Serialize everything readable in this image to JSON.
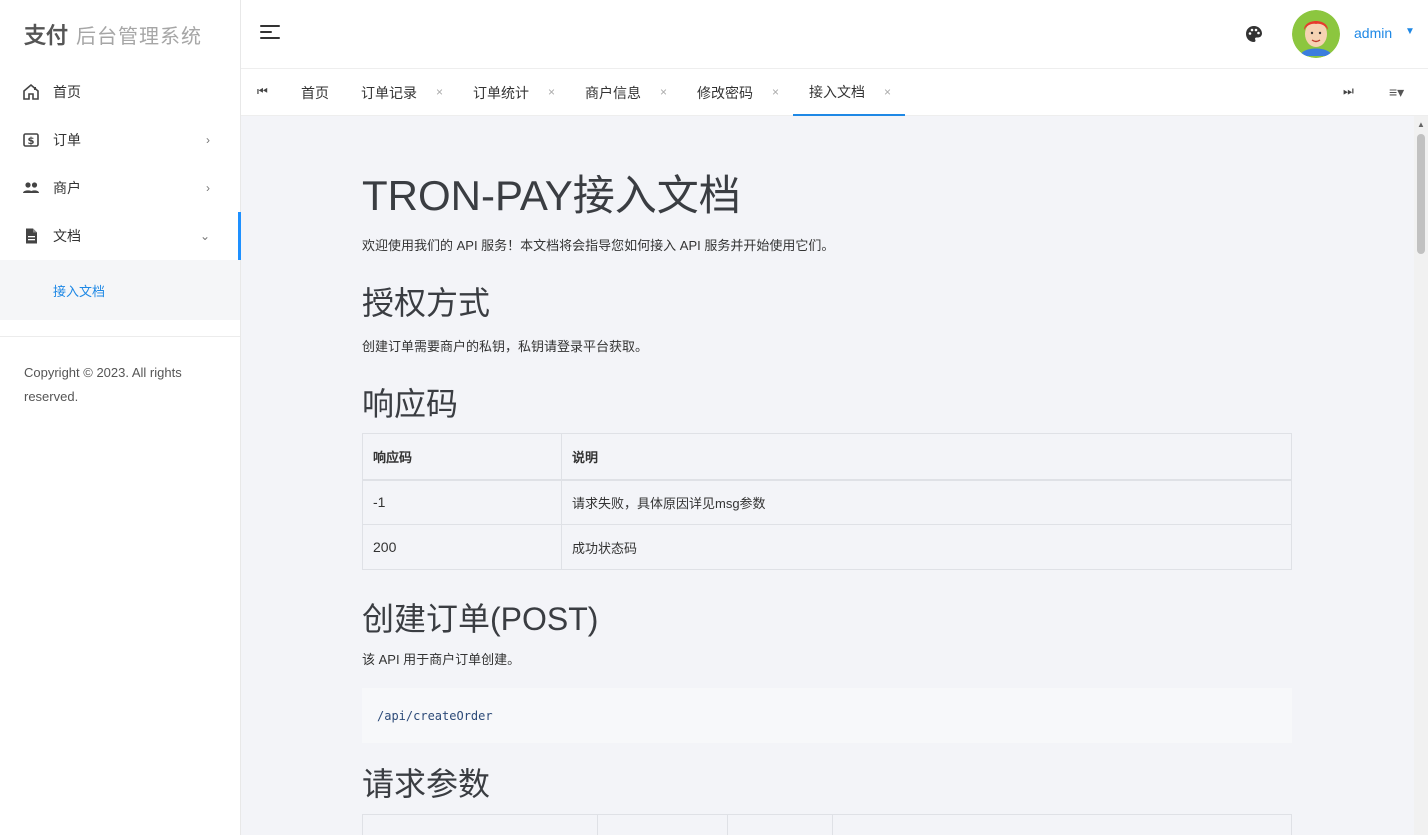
{
  "brand": {
    "mark": "支付",
    "title": "后台管理系统"
  },
  "sidebar": {
    "items": [
      {
        "label": "首页",
        "icon": "home-icon"
      },
      {
        "label": "订单",
        "icon": "dollar-card-icon",
        "chevron": "›"
      },
      {
        "label": "商户",
        "icon": "people-icon",
        "chevron": "›"
      },
      {
        "label": "文档",
        "icon": "document-icon",
        "chevron": "⌄"
      }
    ],
    "sub_item": "接入文档",
    "copyright": "Copyright © 2023. All rights reserved."
  },
  "header": {
    "user": "admin",
    "caret": "▼"
  },
  "tabs": [
    {
      "label": "首页"
    },
    {
      "label": "订单记录",
      "close": "×"
    },
    {
      "label": "订单统计",
      "close": "×"
    },
    {
      "label": "商户信息",
      "close": "×"
    },
    {
      "label": "修改密码",
      "close": "×"
    },
    {
      "label": "接入文档",
      "close": "×"
    }
  ],
  "tab_controls": {
    "first": "⏮",
    "last": "⏭",
    "menu": "≡▾"
  },
  "doc": {
    "title": "TRON-PAY接入文档",
    "intro": "欢迎使用我们的 API 服务！本文档将会指导您如何接入 API 服务并开始使用它们。",
    "auth_heading": "授权方式",
    "auth_text": "创建订单需要商户的私钥，私钥请登录平台获取。",
    "code_heading": "响应码",
    "code_table": {
      "headers": [
        "响应码",
        "说明"
      ],
      "rows": [
        [
          "-1",
          "请求失败，具体原因详见msg参数"
        ],
        [
          "200",
          "成功状态码"
        ]
      ]
    },
    "create_heading": "创建订单(POST)",
    "create_text": "该 API 用于商户订单创建。",
    "endpoint": "/api/createOrder",
    "params_heading": "请求参数"
  },
  "colors": {
    "accent": "#1e88e5",
    "content_bg": "#f3f4f8"
  }
}
